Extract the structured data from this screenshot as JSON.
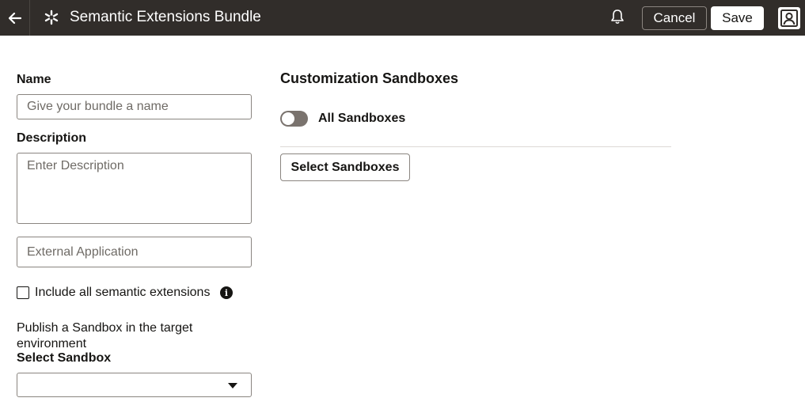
{
  "header": {
    "title": "Semantic Extensions Bundle",
    "back_icon": "arrow-left-icon",
    "app_icon": "snowflake-icon",
    "notification_icon": "bell-icon",
    "cancel_label": "Cancel",
    "save_label": "Save",
    "user_icon": "user-avatar-icon"
  },
  "form": {
    "name_label": "Name",
    "name_placeholder": "Give your bundle a name",
    "description_label": "Description",
    "description_placeholder": "Enter Description",
    "external_app_placeholder": "External Application",
    "include_all_label": "Include all semantic extensions",
    "include_all_checked": false,
    "info_icon": "info-icon",
    "publish_text": "Publish a Sandbox in the target environment",
    "select_sandbox_label": "Select Sandbox",
    "select_sandbox_value": ""
  },
  "sandboxes": {
    "title": "Customization Sandboxes",
    "all_sandboxes_label": "All Sandboxes",
    "all_sandboxes_on": false,
    "select_button_label": "Select Sandboxes"
  },
  "colors": {
    "header_bg": "#312d2a",
    "toggle_off": "#7a736e"
  }
}
